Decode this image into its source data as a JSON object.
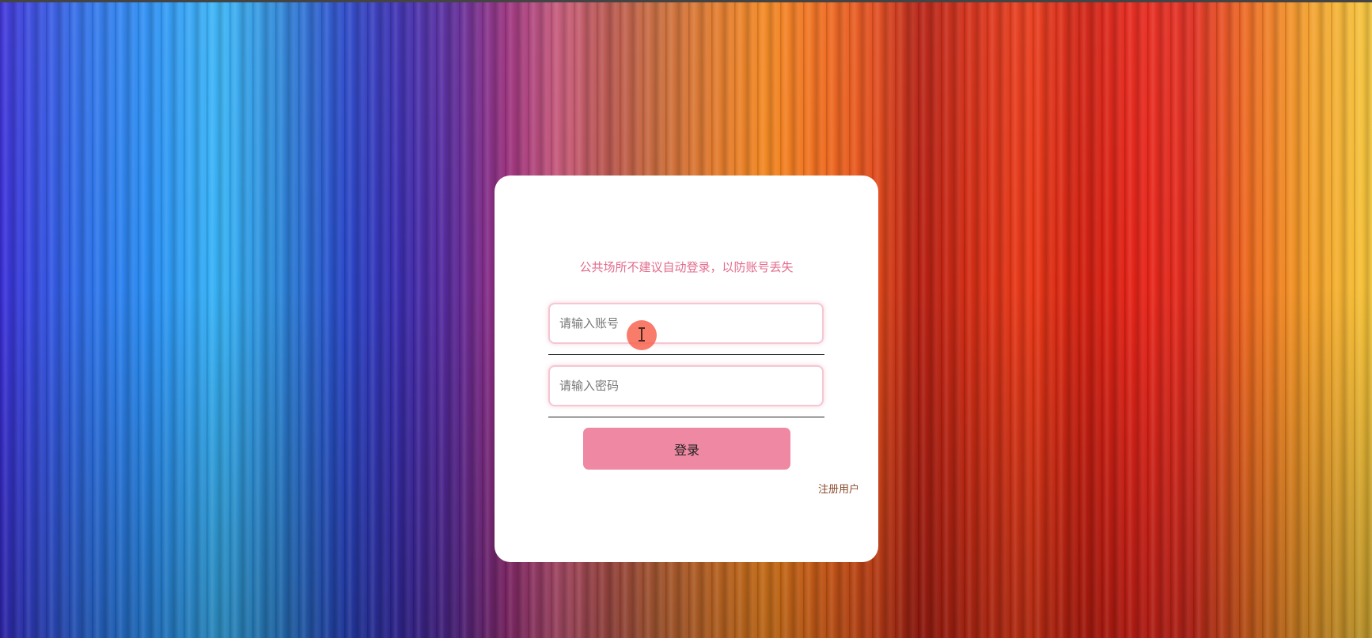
{
  "login": {
    "notice": "公共场所不建议自动登录，以防账号丢失",
    "username_placeholder": "请输入账号",
    "password_placeholder": "请输入密码",
    "login_label": "登录",
    "register_label": "注册用户"
  },
  "colors": {
    "card_background": "#ffffff",
    "notice_text": "#e36b8c",
    "button_background": "#ef88a2",
    "input_border": "#f4c7d3",
    "register_text": "#8a4a2a"
  },
  "icons": {
    "cursor": "text-ibeam-cursor-icon"
  }
}
